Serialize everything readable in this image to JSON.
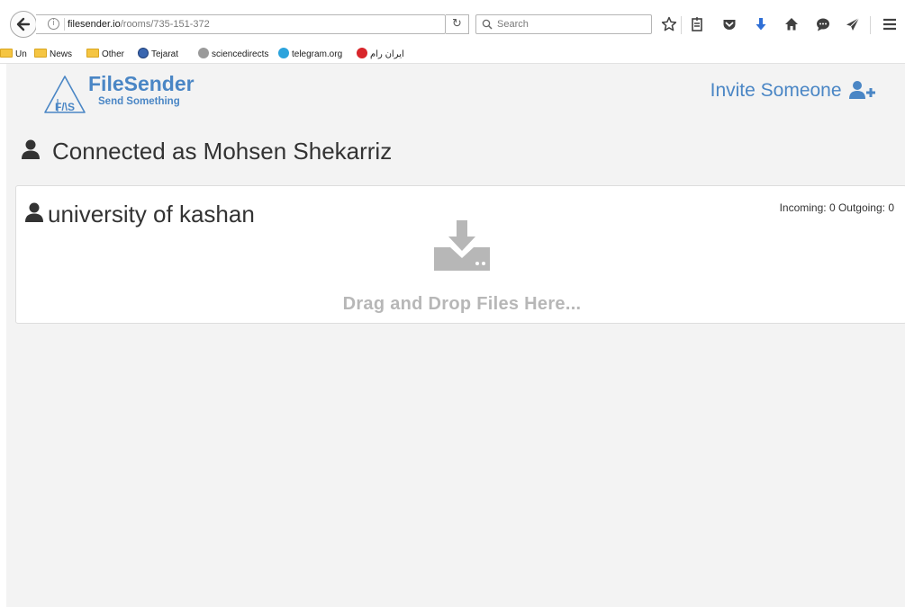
{
  "browser": {
    "url_host": "filesender.io",
    "url_path": "/rooms/735-151-372",
    "search_placeholder": "Search",
    "bookmarks": [
      {
        "label": "Un"
      },
      {
        "label": "News"
      },
      {
        "label": "Other"
      },
      {
        "label": "Tejarat"
      },
      {
        "label": "sciencedirects"
      },
      {
        "label": "telegram.org"
      },
      {
        "label": "ایران رام"
      }
    ]
  },
  "page": {
    "logo_title": "FileSender",
    "logo_tagline": "Send Something",
    "logo_mark_letters": "F/\\S",
    "invite_label": "Invite Someone",
    "connected_text": "Connected as Mohsen Shekarriz",
    "room": {
      "name": "university of kashan",
      "stats": "Incoming: 0 Outgoing: 0",
      "drop_text": "Drag and Drop Files Here..."
    }
  },
  "colors": {
    "brand_blue": "#4a86c5",
    "page_background": "#f3f3f3",
    "drop_gray": "#b7b7b7"
  }
}
